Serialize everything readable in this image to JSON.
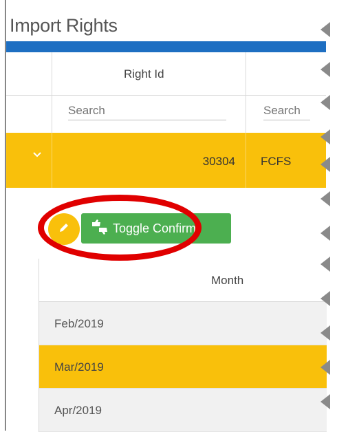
{
  "panel": {
    "title": "Import Rights"
  },
  "grid": {
    "columns": [
      {
        "label": "Right Id"
      }
    ],
    "search": {
      "placeholder_1": "Search",
      "placeholder_2": "Search"
    },
    "row": {
      "expand_icon": "chevron-down-icon",
      "right_id": "30304",
      "type": "FCFS"
    }
  },
  "actions": {
    "edit_icon": "pencil-icon",
    "toggle_icon": "thumbs-up-down-icon",
    "toggle_label": "Toggle Confirm"
  },
  "months": {
    "header": "Month",
    "rows": [
      {
        "label": "Feb/2019",
        "selected": false
      },
      {
        "label": "Mar/2019",
        "selected": true
      },
      {
        "label": "Apr/2019",
        "selected": false
      }
    ]
  },
  "colors": {
    "accent": "#f9c00b",
    "title_bar": "#1e6fc2",
    "toggle": "#4caf50",
    "highlight": "#e00000"
  }
}
